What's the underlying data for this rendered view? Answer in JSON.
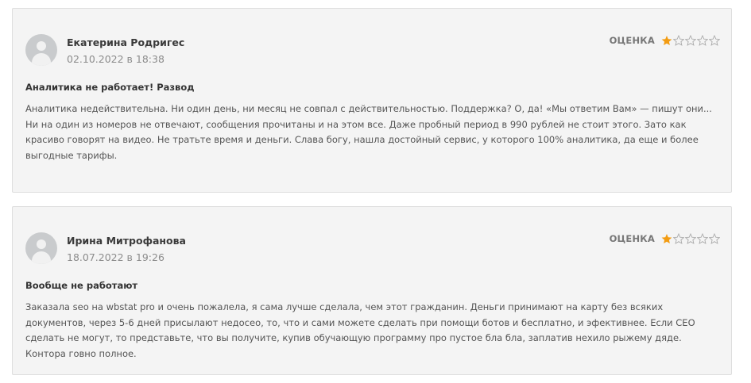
{
  "rating_label": "ОЦЕНКА",
  "colors": {
    "star_filled": "#f39c12",
    "star_empty": "#aaaaaa"
  },
  "reviews": [
    {
      "author": "Екатерина Родригес",
      "date": "02.10.2022 в 18:38",
      "rating": 1,
      "max_rating": 5,
      "title": "Аналитика не работает! Развод",
      "paragraphs": [
        "Аналитика недействительна. Ни один день, ни месяц не совпал с действительностью. Поддержка? О, да! «Мы ответим Вам» — пишут они...",
        "Ни на один из номеров не отвечают, сообщения прочитаны и на этом все. Даже пробный период в 990 рублей не стоит этого. Зато как красиво говорят на видео. Не тратьте время и деньги. Слава богу, нашла достойный сервис, у которого 100% аналитика, да еще и более выгодные тарифы."
      ]
    },
    {
      "author": "Ирина Митрофанова",
      "date": "18.07.2022 в 19:26",
      "rating": 1,
      "max_rating": 5,
      "title": "Вообще не работают",
      "paragraphs": [
        "Заказала seo на wbstat pro и очень пожалела, я сама лучше сделала, чем этот гражданин. Деньги принимают на карту без всяких документов, через 5-6 дней присылают недосео, то, что и сами можете сделать при помощи ботов и бесплатно, и эфективнее. Если СЕО сделать не могут, то представьте, что вы получите, купив обучающую программу про пустое бла бла, заплатив нехило рыжему дяде. Контора говно полное."
      ]
    }
  ]
}
